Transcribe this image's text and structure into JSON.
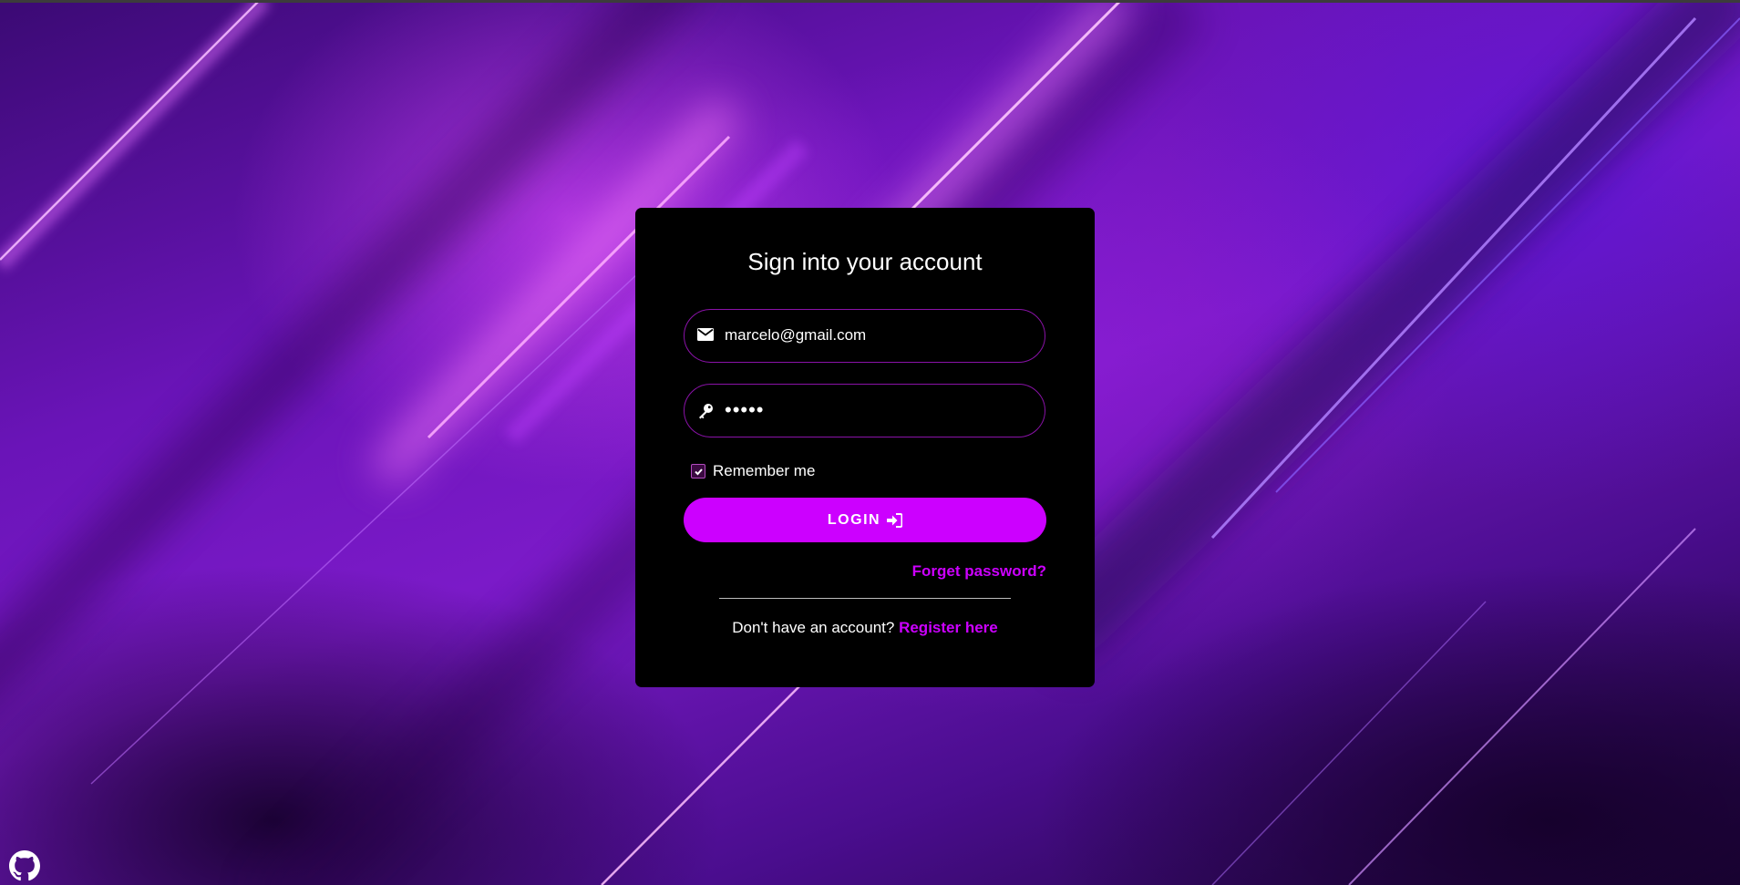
{
  "background": {
    "accent_color": "#cc00ff",
    "base_color": "#6a14b8"
  },
  "login_form": {
    "title": "Sign into your account",
    "email": {
      "icon": "envelope-icon",
      "value": "marcelo@gmail.com"
    },
    "password": {
      "icon": "key-icon",
      "masked_value": "•••••"
    },
    "remember_me": {
      "label": "Remember me",
      "checked": true
    },
    "login_button": {
      "label": "LOGIN",
      "icon": "sign-in-icon"
    },
    "forgot_password_label": "Forget password?",
    "register_prompt": "Don't have an account?",
    "register_link_label": "Register here"
  },
  "footer": {
    "github_icon": "github-icon"
  }
}
